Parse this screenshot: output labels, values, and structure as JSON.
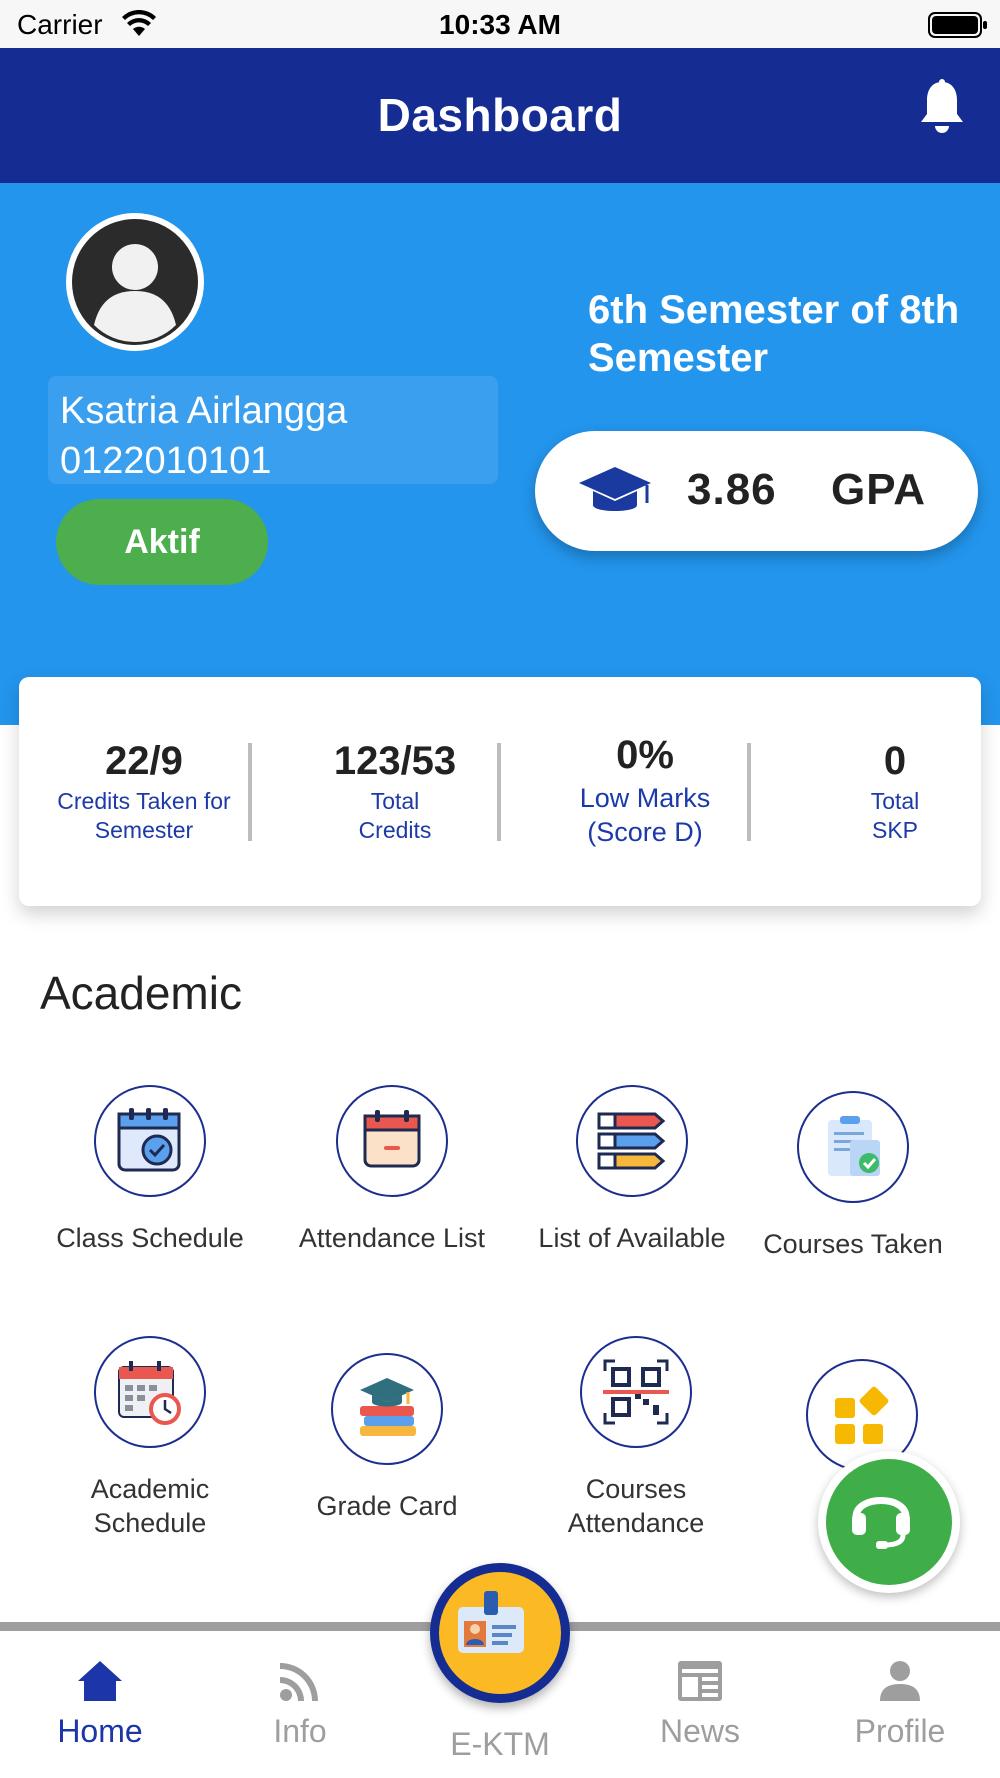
{
  "status_bar": {
    "carrier": "Carrier",
    "time": "10:33 AM"
  },
  "header": {
    "title": "Dashboard"
  },
  "profile": {
    "name": "Ksatria Airlangga",
    "student_id": "0122010101",
    "status": "Aktif",
    "semester": "6th Semester of 8th Semester",
    "gpa_value": "3.86",
    "gpa_label": "GPA"
  },
  "stats": [
    {
      "value": "22/9",
      "label": "Credits Taken for Semester"
    },
    {
      "value": "123/53",
      "label": "Total Credits"
    },
    {
      "value": "0%",
      "label": "Low Marks (Score D)"
    },
    {
      "value": "0",
      "label": "Total SKP"
    }
  ],
  "academic": {
    "title": "Academic",
    "items": [
      {
        "label": "Class Schedule",
        "icon": "calendar-check-icon"
      },
      {
        "label": "Attendance List",
        "icon": "calendar-icon"
      },
      {
        "label": "List of Available",
        "icon": "numbered-list-icon"
      },
      {
        "label": "Courses Taken",
        "icon": "clipboard-check-icon"
      },
      {
        "label": "Academic Schedule",
        "icon": "calendar-clock-icon"
      },
      {
        "label": "Grade Card",
        "icon": "books-graduation-icon"
      },
      {
        "label": "Courses Attendance",
        "icon": "qr-code-icon"
      },
      {
        "label": "",
        "icon": "apps-grid-icon"
      }
    ]
  },
  "bottom_nav": {
    "items": [
      {
        "label": "Home",
        "icon": "home-icon",
        "active": true
      },
      {
        "label": "Info",
        "icon": "rss-icon",
        "active": false
      },
      {
        "label": "E-KTM",
        "icon": "id-card-icon",
        "active": false
      },
      {
        "label": "News",
        "icon": "newspaper-icon",
        "active": false
      },
      {
        "label": "Profile",
        "icon": "person-icon",
        "active": false
      }
    ]
  },
  "colors": {
    "header": "#152c92",
    "hero": "#2395ec",
    "status_green": "#4cae4c",
    "support_green": "#3fae49",
    "ektm_yellow": "#fbb924",
    "link_blue": "#1c3aa8"
  }
}
